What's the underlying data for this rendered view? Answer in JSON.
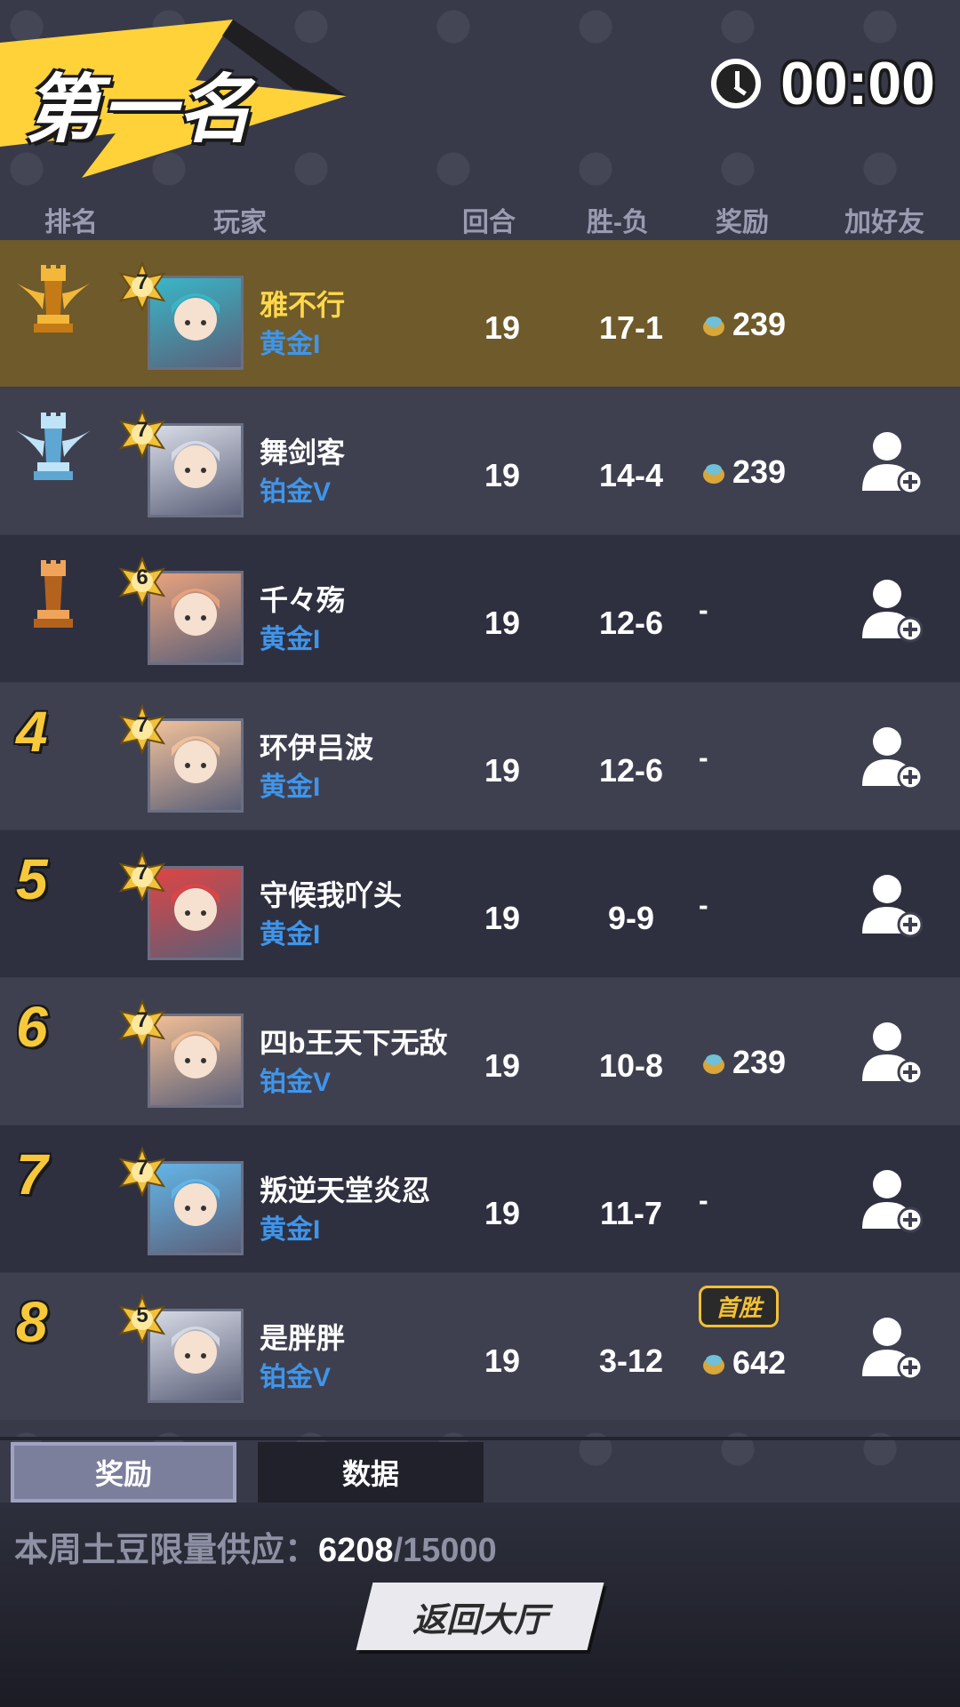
{
  "header": {
    "rank_title": "第一名",
    "timer": "00:00"
  },
  "columns": [
    "排名",
    "玩家",
    "回合",
    "胜-负",
    "奖励",
    "加好友"
  ],
  "rows": [
    {
      "rank": "",
      "trophy": "gold-trophy",
      "level": "7",
      "name": "雅不行",
      "tier": "黄金I",
      "rounds": "19",
      "wl": "17-1",
      "reward": "239",
      "badge": "",
      "is_self": true
    },
    {
      "rank": "",
      "trophy": "silver-trophy",
      "level": "7",
      "name": "舞剑客",
      "tier": "铂金V",
      "rounds": "19",
      "wl": "14-4",
      "reward": "239",
      "badge": "",
      "is_self": false
    },
    {
      "rank": "",
      "trophy": "bronze-trophy",
      "level": "6",
      "name": "千々殇",
      "tier": "黄金I",
      "rounds": "19",
      "wl": "12-6",
      "reward": "-",
      "badge": "",
      "is_self": false
    },
    {
      "rank": "4",
      "trophy": "",
      "level": "7",
      "name": "环伊吕波",
      "tier": "黄金I",
      "rounds": "19",
      "wl": "12-6",
      "reward": "-",
      "badge": "",
      "is_self": false
    },
    {
      "rank": "5",
      "trophy": "",
      "level": "7",
      "name": "守候我吖头",
      "tier": "黄金I",
      "rounds": "19",
      "wl": "9-9",
      "reward": "-",
      "badge": "",
      "is_self": false
    },
    {
      "rank": "6",
      "trophy": "",
      "level": "7",
      "name": "四b王天下无敌",
      "tier": "铂金V",
      "rounds": "19",
      "wl": "10-8",
      "reward": "239",
      "badge": "",
      "is_self": false
    },
    {
      "rank": "7",
      "trophy": "",
      "level": "7",
      "name": "叛逆天堂炎忍",
      "tier": "黄金I",
      "rounds": "19",
      "wl": "11-7",
      "reward": "-",
      "badge": "",
      "is_self": false
    },
    {
      "rank": "8",
      "trophy": "",
      "level": "5",
      "name": "是胖胖",
      "tier": "铂金V",
      "rounds": "19",
      "wl": "3-12",
      "reward": "642",
      "badge": "首胜",
      "is_self": false
    }
  ],
  "tabs": {
    "reward": "奖励",
    "data": "数据"
  },
  "supply": {
    "label": "本周土豆限量供应：",
    "current": "6208",
    "total": "/15000"
  },
  "back_button": "返回大厅",
  "colors": {
    "accent": "#f7c93a",
    "tier_blue": "#3f95ea",
    "self_row": "#6e5a2a"
  }
}
